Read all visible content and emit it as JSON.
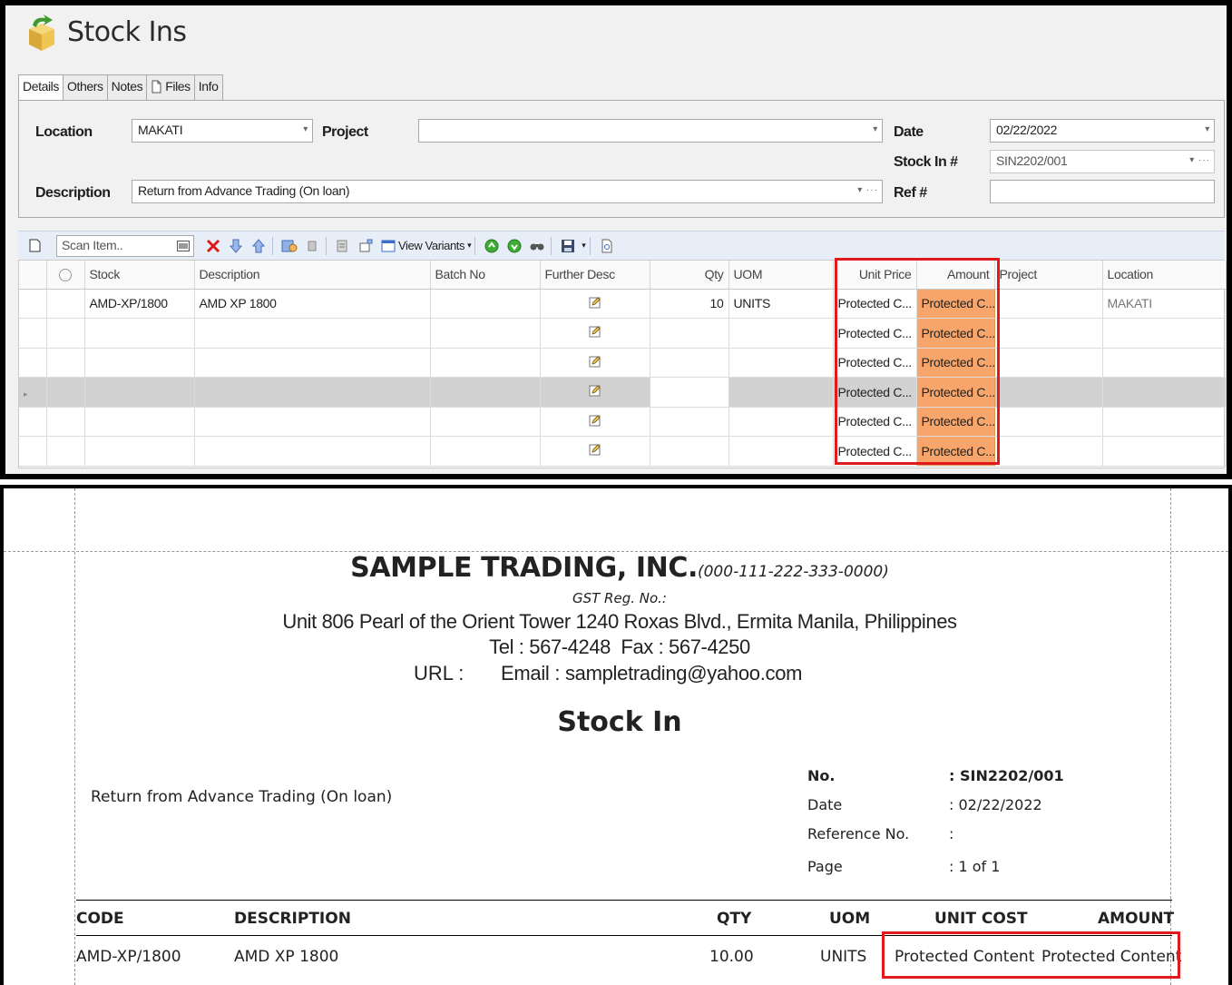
{
  "app": {
    "title": "Stock Ins",
    "tabs": [
      {
        "label": "Details",
        "active": true
      },
      {
        "label": "Others",
        "active": false
      },
      {
        "label": "Notes",
        "active": false
      },
      {
        "label": "Files",
        "active": false
      },
      {
        "label": "Info",
        "active": false
      }
    ]
  },
  "form": {
    "location_label": "Location",
    "location_value": "MAKATI",
    "project_label": "Project",
    "project_value": "",
    "date_label": "Date",
    "date_value": "02/22/2022",
    "stock_in_label": "Stock In #",
    "stock_in_value": "SIN2202/001",
    "description_label": "Description",
    "description_value": "Return from Advance Trading (On loan)",
    "ref_label": "Ref #",
    "ref_value": ""
  },
  "toolbar": {
    "scan_placeholder": "Scan Item..",
    "view_variants_label": "View Variants"
  },
  "grid": {
    "columns": [
      "Stock",
      "Description",
      "Batch No",
      "Further Desc",
      "Qty",
      "UOM",
      "Unit Price",
      "Amount",
      "Project",
      "Location"
    ],
    "rows": [
      {
        "stock": "AMD-XP/1800",
        "description": "AMD XP 1800",
        "batch": "",
        "qty": "10",
        "uom": "UNITS",
        "unit_price": "Protected C...",
        "amount": "Protected C...",
        "project": "",
        "location": "MAKATI"
      },
      {
        "stock": "",
        "description": "",
        "batch": "",
        "qty": "",
        "uom": "",
        "unit_price": "Protected C...",
        "amount": "Protected C...",
        "project": "",
        "location": ""
      },
      {
        "stock": "",
        "description": "",
        "batch": "",
        "qty": "",
        "uom": "",
        "unit_price": "Protected C...",
        "amount": "Protected C...",
        "project": "",
        "location": ""
      },
      {
        "stock": "",
        "description": "",
        "batch": "",
        "qty": "",
        "uom": "",
        "unit_price": "Protected C...",
        "amount": "Protected C...",
        "project": "",
        "location": ""
      },
      {
        "stock": "",
        "description": "",
        "batch": "",
        "qty": "",
        "uom": "",
        "unit_price": "Protected C...",
        "amount": "Protected C...",
        "project": "",
        "location": ""
      },
      {
        "stock": "",
        "description": "",
        "batch": "",
        "qty": "",
        "uom": "",
        "unit_price": "Protected C...",
        "amount": "Protected C...",
        "project": "",
        "location": ""
      }
    ]
  },
  "report": {
    "company_name": "SAMPLE TRADING, INC.",
    "company_reg": "(000-111-222-333-0000)",
    "gst": "GST Reg. No.:",
    "address": "Unit 806 Pearl of the Orient Tower 1240 Roxas Blvd., Ermita Manila, Philippines",
    "tel": "Tel : 567-4248  Fax : 567-4250",
    "url_label": "URL :",
    "email": "Email : sampletrading@yahoo.com",
    "doc_title": "Stock In",
    "description": "Return from Advance Trading (On loan)",
    "info": [
      {
        "label": "No.",
        "value": ": SIN2202/001"
      },
      {
        "label": "Date",
        "value": ": 02/22/2022"
      },
      {
        "label": "Reference No.",
        "value": ":"
      },
      {
        "label": "Page",
        "value": ": 1 of 1"
      }
    ],
    "headers": {
      "code": "CODE",
      "description": "DESCRIPTION",
      "qty": "QTY",
      "uom": "UOM",
      "unit_cost": "UNIT COST",
      "amount": "AMOUNT"
    },
    "row": {
      "code": "AMD-XP/1800",
      "description": "AMD XP 1800",
      "qty": "10.00",
      "uom": "UNITS",
      "unit_cost": "Protected Content",
      "amount": "Protected Content"
    }
  },
  "colors": {
    "highlight_border": "#e11b1b",
    "amount_fill": "#f7a56a"
  }
}
